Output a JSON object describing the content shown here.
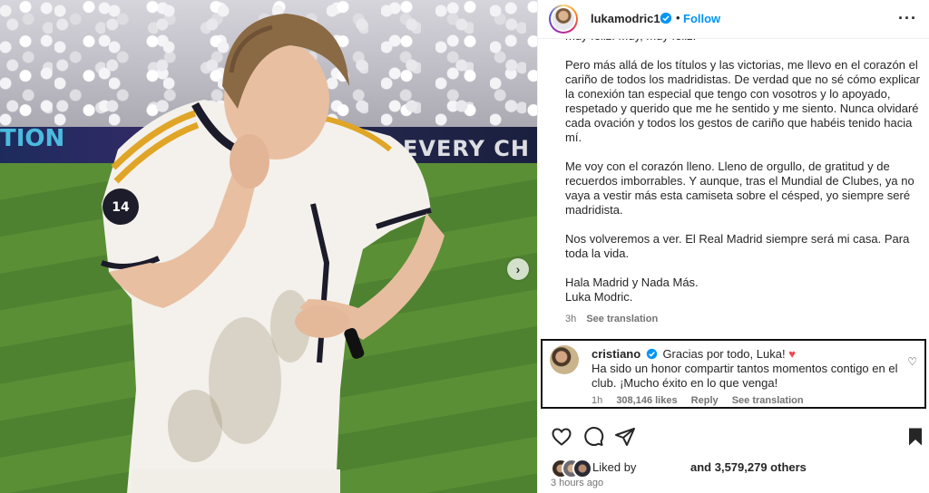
{
  "photo": {
    "board_text_right": "USE EVERY CH",
    "board_text_left": "TION",
    "jersey_number": "14",
    "next_label": "›"
  },
  "header": {
    "username": "lukamodric10",
    "separator": "•",
    "follow": "Follow",
    "more": "···"
  },
  "caption": {
    "clipped_line": "muy feliz. Muy, muy feliz.",
    "paragraphs": [
      "Pero más allá de los títulos y las victorias, me llevo en el corazón el cariño de todos los madridistas. De verdad que no sé cómo explicar la conexión tan especial que tengo con vosotros y lo apoyado, respetado y querido que me he sentido y me siento. Nunca olvidaré cada ovación y todos los gestos de cariño que habéis tenido hacia mí.",
      "Me voy con el corazón lleno. Lleno de orgullo, de gratitud y de recuerdos imborrables. Y aunque, tras el Mundial de Clubes, ya no vaya a vestir más esta camiseta sobre el césped, yo siempre seré madridista.",
      "Nos volveremos a ver. El Real Madrid siempre será mi casa. Para toda la vida.",
      "Hala Madrid y Nada Más.\nLuka Modric."
    ],
    "time": "3h",
    "see_translation": "See translation"
  },
  "comment": {
    "username": "cristiano",
    "text_first": "Gracias por todo, Luka!",
    "heart": "♥",
    "text_rest": "Ha sido un honor compartir tantos momentos contigo en el club. ¡Mucho éxito en lo que venga!",
    "time": "1h",
    "likes": "308,146 likes",
    "reply": "Reply",
    "see_translation": "See translation",
    "like_icon": "♡"
  },
  "likes": {
    "liked_by": "Liked by",
    "others": "and 3,579,279 others",
    "time_ago": "3 hours ago"
  },
  "colors": {
    "accent": "#0095f6",
    "verified": "#0095f6",
    "heart": "#ed4956",
    "muted": "#737373"
  },
  "icons": [
    "heart-icon",
    "comment-icon",
    "share-icon",
    "bookmark-icon",
    "verified-badge-icon",
    "more-options-icon",
    "chevron-right-icon"
  ]
}
